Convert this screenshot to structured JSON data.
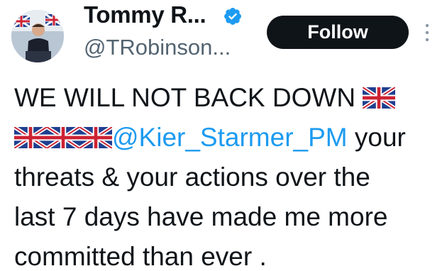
{
  "author": {
    "display_name": "Tommy R...",
    "handle": "@TRobinson...",
    "verified_icon": "verified-badge-icon"
  },
  "actions": {
    "follow_label": "Follow",
    "more_icon": "more-vertical-icon"
  },
  "tweet": {
    "line1_text": "WE WILL NOT BACK DOWN",
    "mention": "@Kier_Starmer_PM",
    "line2_suffix": " your",
    "line3": "threats & your actions over the",
    "line4": "last 7 days have made me more",
    "line5": "committed than ever .",
    "flag_icon": "uk-flag-emoji"
  },
  "colors": {
    "text": "#0f1419",
    "secondary_text": "#536471",
    "mention": "#1d9bf0",
    "verified": "#1d9bf0",
    "button_bg": "#0f1419",
    "button_text": "#ffffff"
  }
}
